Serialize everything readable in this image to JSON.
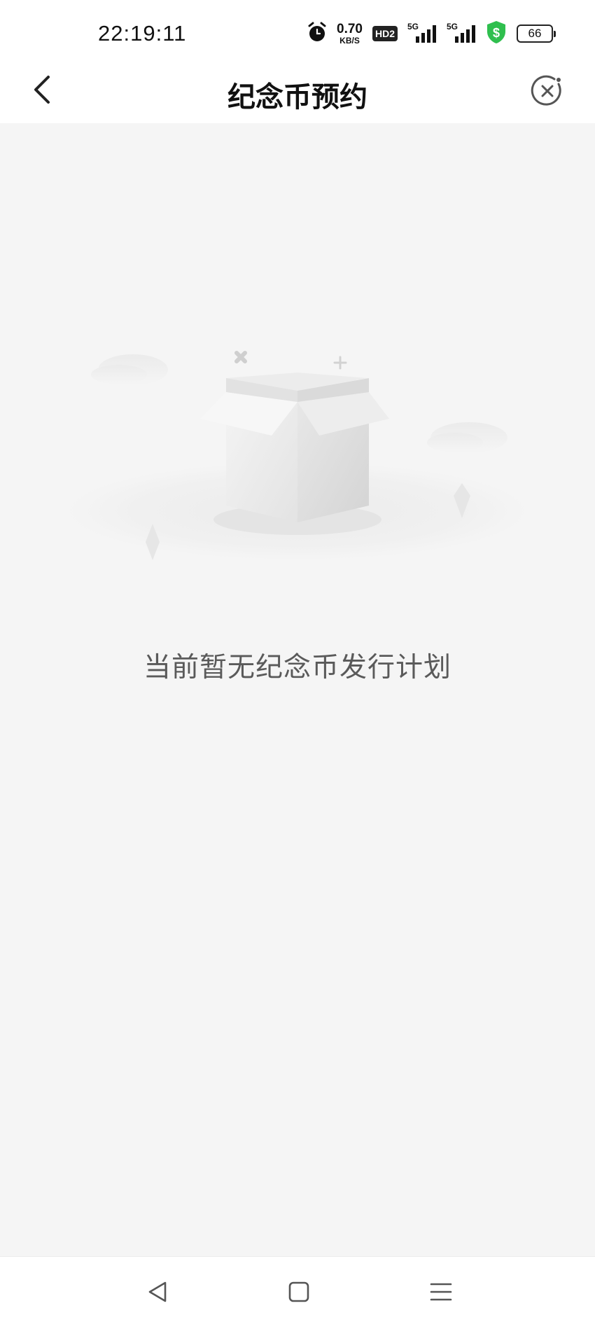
{
  "status_bar": {
    "time": "22:19:11",
    "net_speed_value": "0.70",
    "net_speed_unit": "KB/S",
    "hd_badge": "HD2",
    "signal1_label": "5G",
    "signal2_label": "5G",
    "battery_level": "66",
    "icons": [
      "alarm-icon",
      "hd-icon",
      "signal-5g-icon",
      "signal-5g-icon",
      "security-shield-icon",
      "battery-icon"
    ],
    "shield_color": "#2fbf4e"
  },
  "header": {
    "title": "纪念币预约",
    "back_icon": "chevron-left-icon",
    "close_icon": "close-circle-icon"
  },
  "empty_state": {
    "message": "当前暂无纪念币发行计划",
    "illustration": "empty-box-illustration"
  },
  "nav_bar": {
    "back_icon": "triangle-back-icon",
    "home_icon": "square-home-icon",
    "menu_icon": "hamburger-menu-icon"
  }
}
